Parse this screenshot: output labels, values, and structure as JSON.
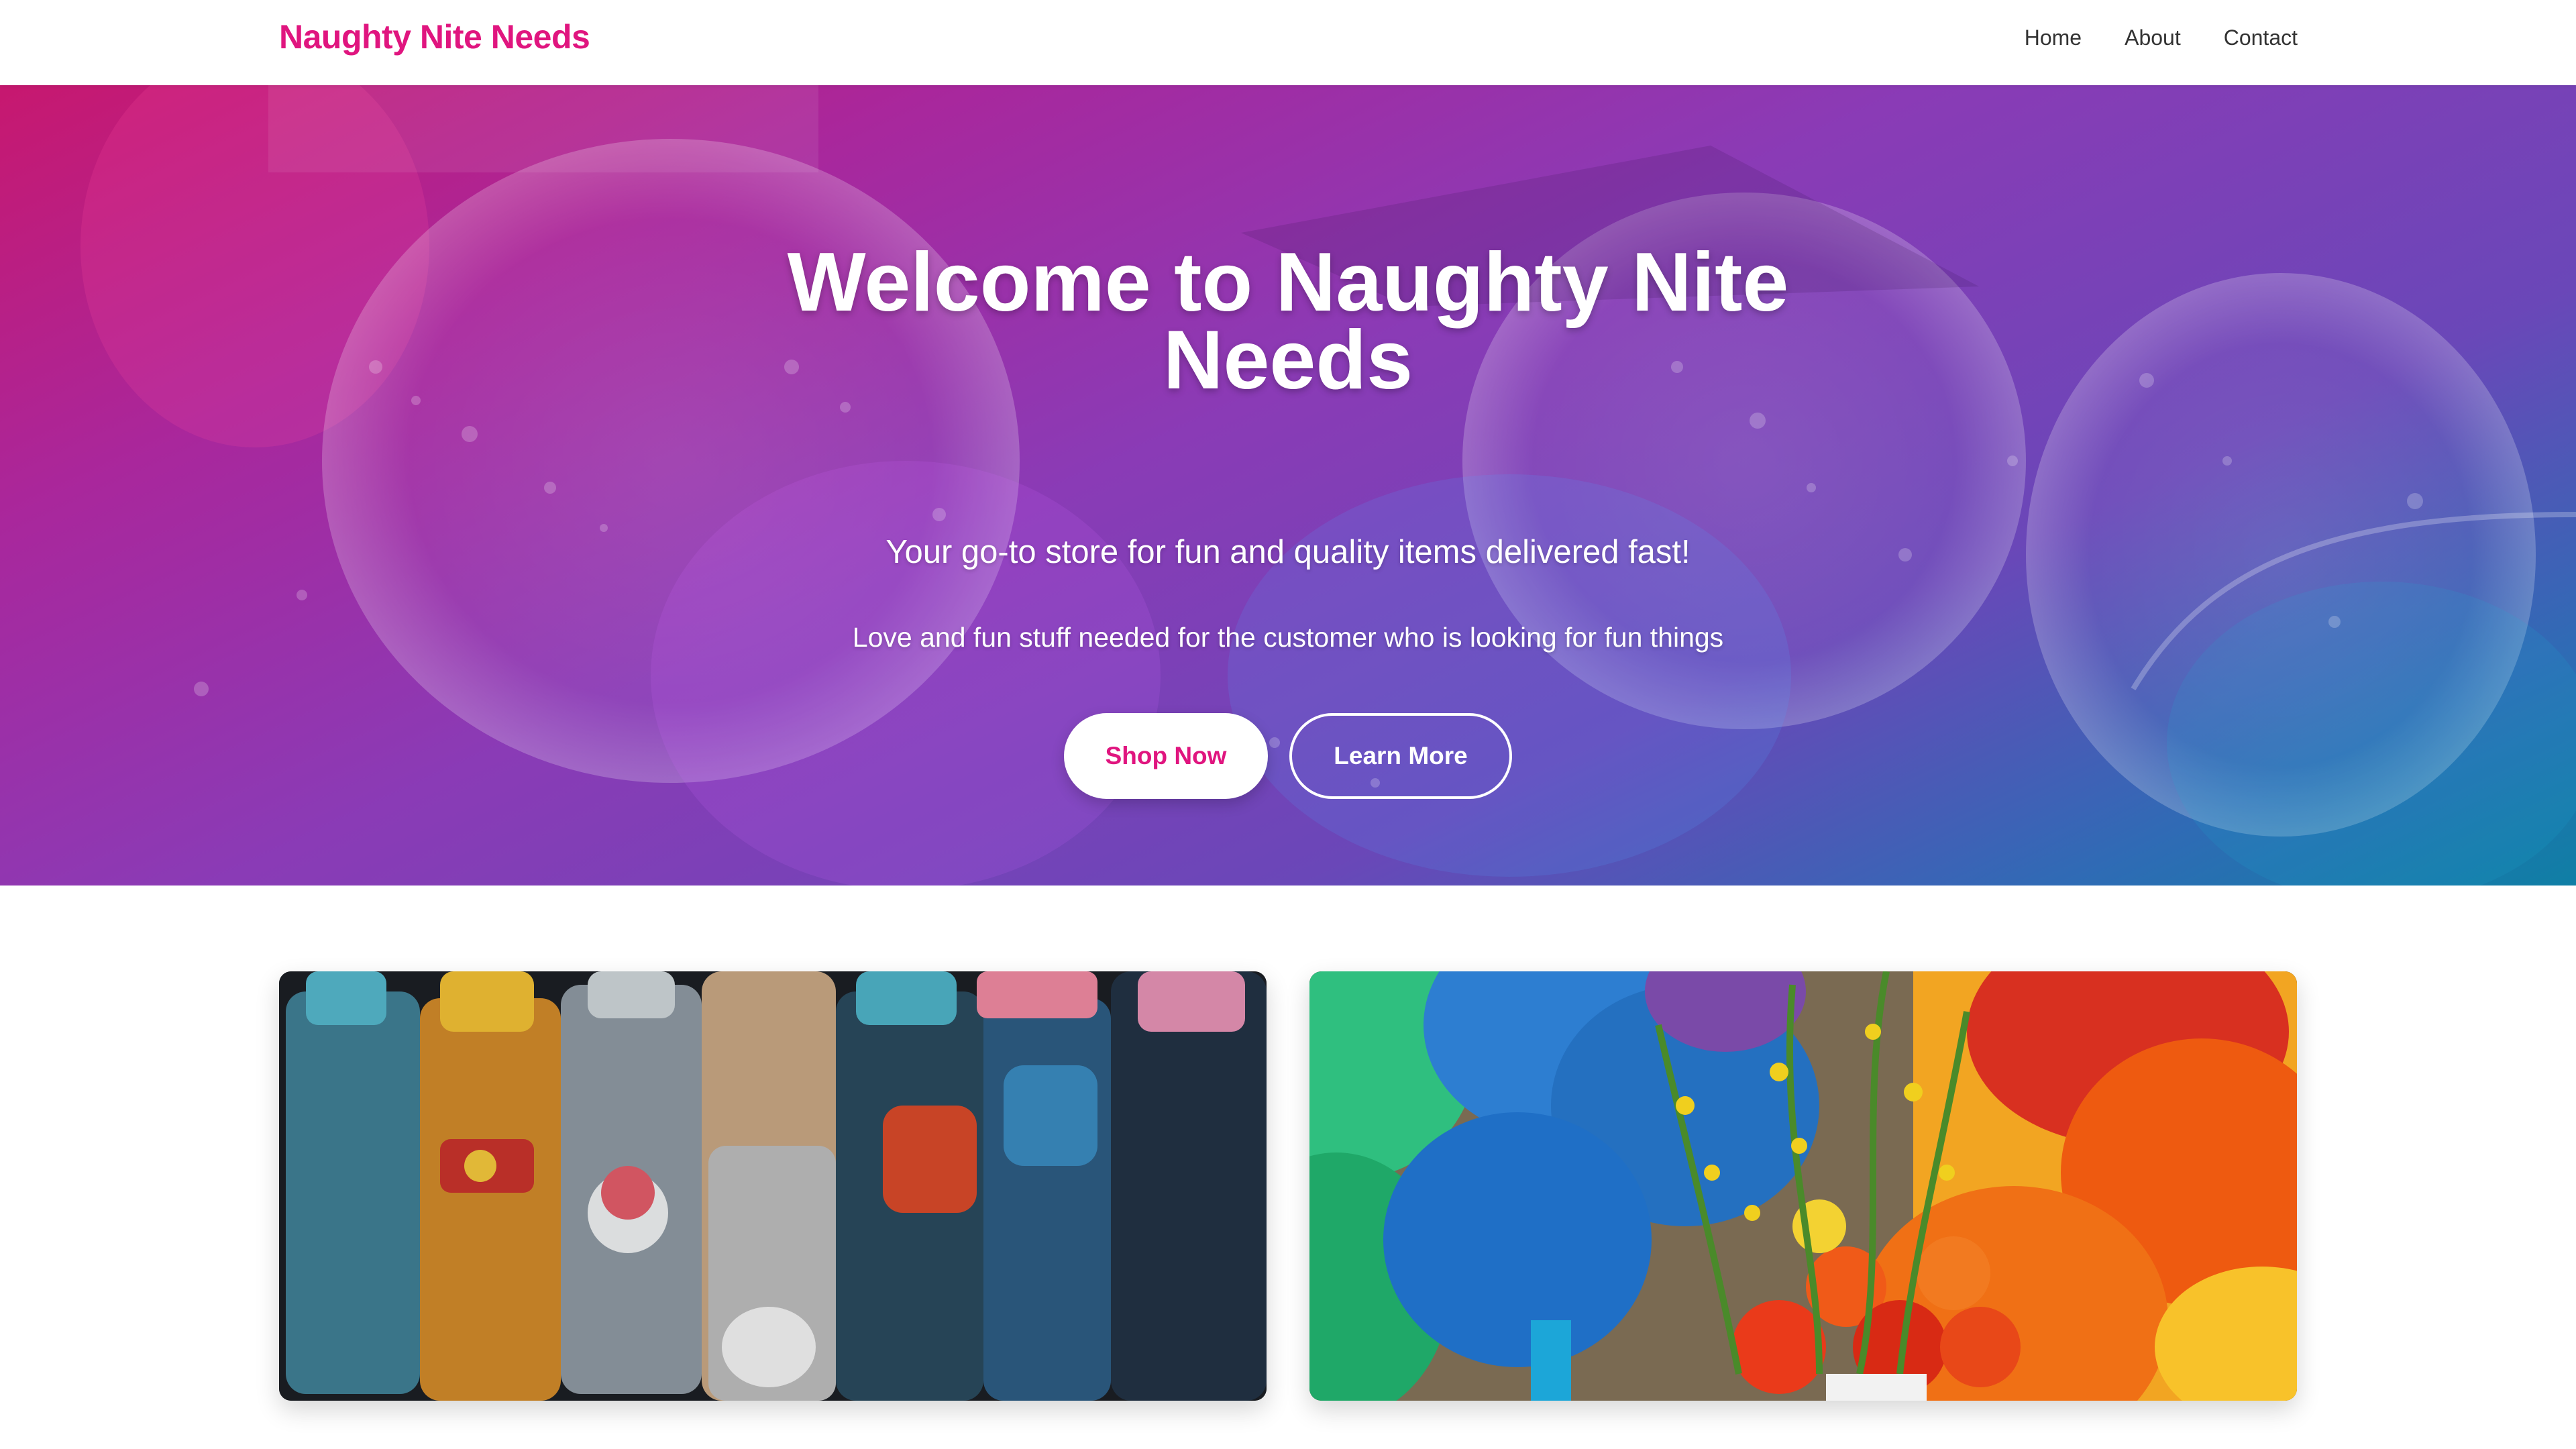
{
  "header": {
    "brand": "Naughty Nite Needs",
    "nav": [
      "Home",
      "About",
      "Contact"
    ]
  },
  "hero": {
    "title": "Welcome to Naughty Nite Needs",
    "tagline": "Your go-to store for fun and quality items delivered fast!",
    "description": "Love and fun stuff needed for the customer who is looking for fun things",
    "primary_button": "Shop Now",
    "secondary_button": "Learn More"
  },
  "colors": {
    "brand_pink": "#e0157f",
    "hero_gradient_start": "#c7186f",
    "hero_gradient_mid": "#8a3bb6",
    "hero_gradient_end": "#0f7fa5"
  },
  "cards": [
    {
      "image": "colorful-water-bottles-image"
    },
    {
      "image": "balloons-and-flowers-image"
    }
  ]
}
